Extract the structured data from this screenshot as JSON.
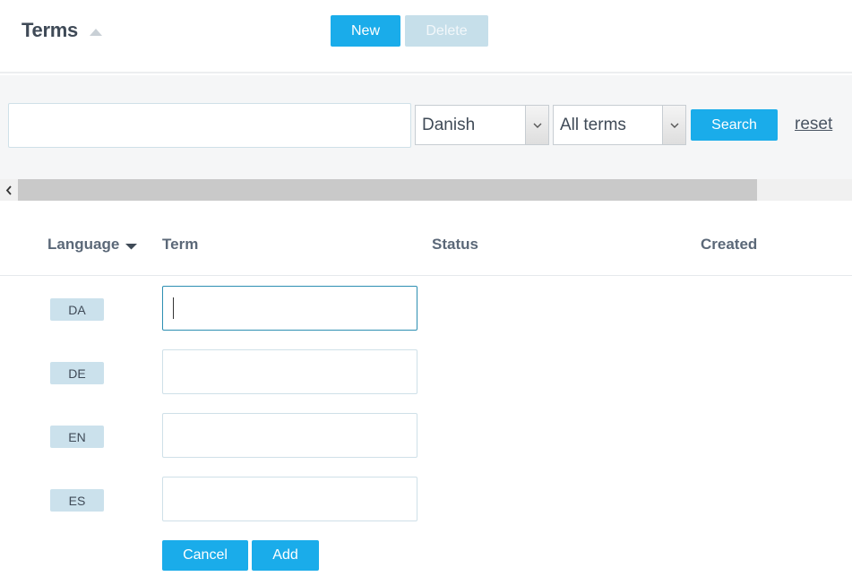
{
  "header": {
    "title": "Terms",
    "new_label": "New",
    "delete_label": "Delete"
  },
  "filters": {
    "search_value": "",
    "language_selected": "Danish",
    "term_filter_selected": "All terms",
    "search_label": "Search",
    "reset_label": "reset"
  },
  "table": {
    "columns": {
      "language": "Language",
      "term": "Term",
      "status": "Status",
      "created": "Created"
    },
    "rows": [
      {
        "lang": "DA",
        "term": ""
      },
      {
        "lang": "DE",
        "term": ""
      },
      {
        "lang": "EN",
        "term": ""
      },
      {
        "lang": "ES",
        "term": ""
      }
    ]
  },
  "actions": {
    "cancel_label": "Cancel",
    "add_label": "Add"
  },
  "colors": {
    "primary": "#1aacea",
    "disabled": "#c6dfea",
    "badge": "#cbe1ec",
    "focus_border": "#2d8fb2"
  },
  "icons": {
    "title_sort": "sort-up-icon",
    "language_sort": "sort-down-icon",
    "select_arrow": "chevron-down-icon",
    "scroll_left": "chevron-left-icon"
  }
}
